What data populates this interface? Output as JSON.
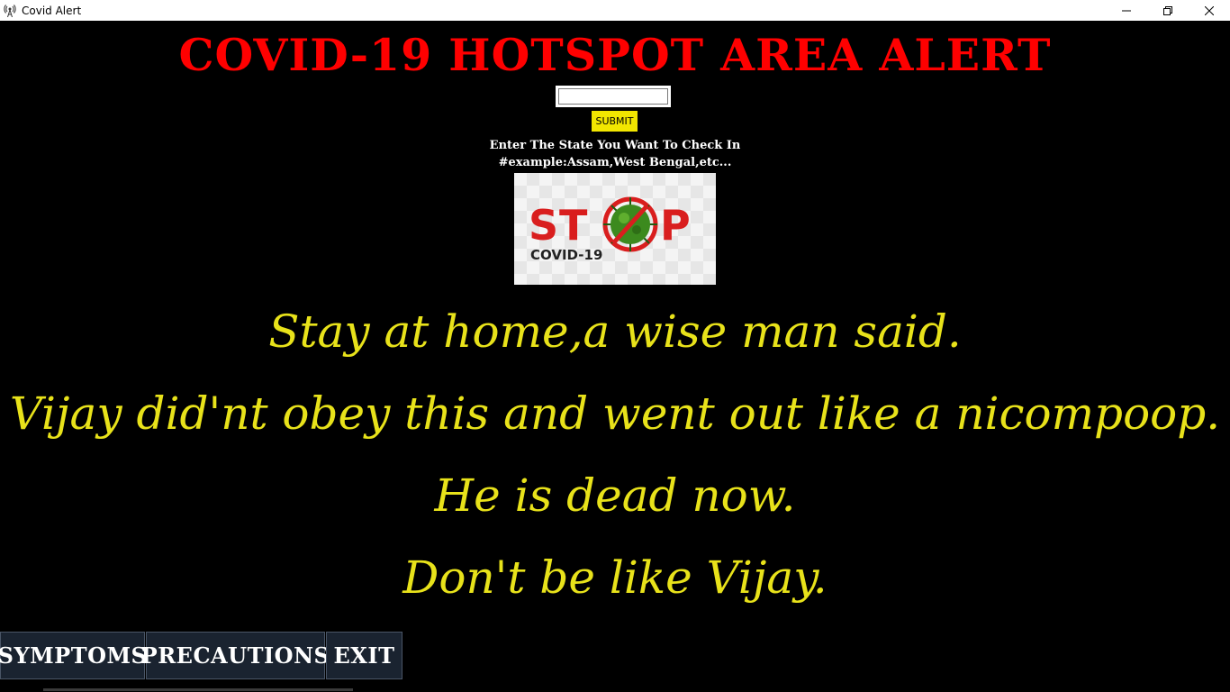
{
  "window": {
    "title": "Covid Alert",
    "icon": "radio-tower-icon",
    "controls": [
      "minimize",
      "restore",
      "close"
    ]
  },
  "headline": "COVID-19 HOTSPOT AREA ALERT",
  "search": {
    "value": "",
    "placeholder": ""
  },
  "submit_label": "SUBMIT",
  "instructions": {
    "line1": "Enter The State You Want To Check In",
    "line2": "#example:Assam,West Bengal,etc..."
  },
  "stop_image": {
    "word": "STOP",
    "caption": "COVID-19"
  },
  "message": {
    "line1": "Stay at home,a wise man said.",
    "line2": "Vijay did'nt obey this and went out like a nicompoop.",
    "line3": "He is dead now.",
    "line4": "Don't be like Vijay."
  },
  "buttons": {
    "symptoms": "SYMPTOMS",
    "precautions": "PRECAUTIONS",
    "exit": "EXIT"
  },
  "colors": {
    "background": "#000000",
    "headline": "#ff0000",
    "message": "#e8e21a",
    "submit": "#f2e600",
    "nav_button": "#1a2330"
  }
}
